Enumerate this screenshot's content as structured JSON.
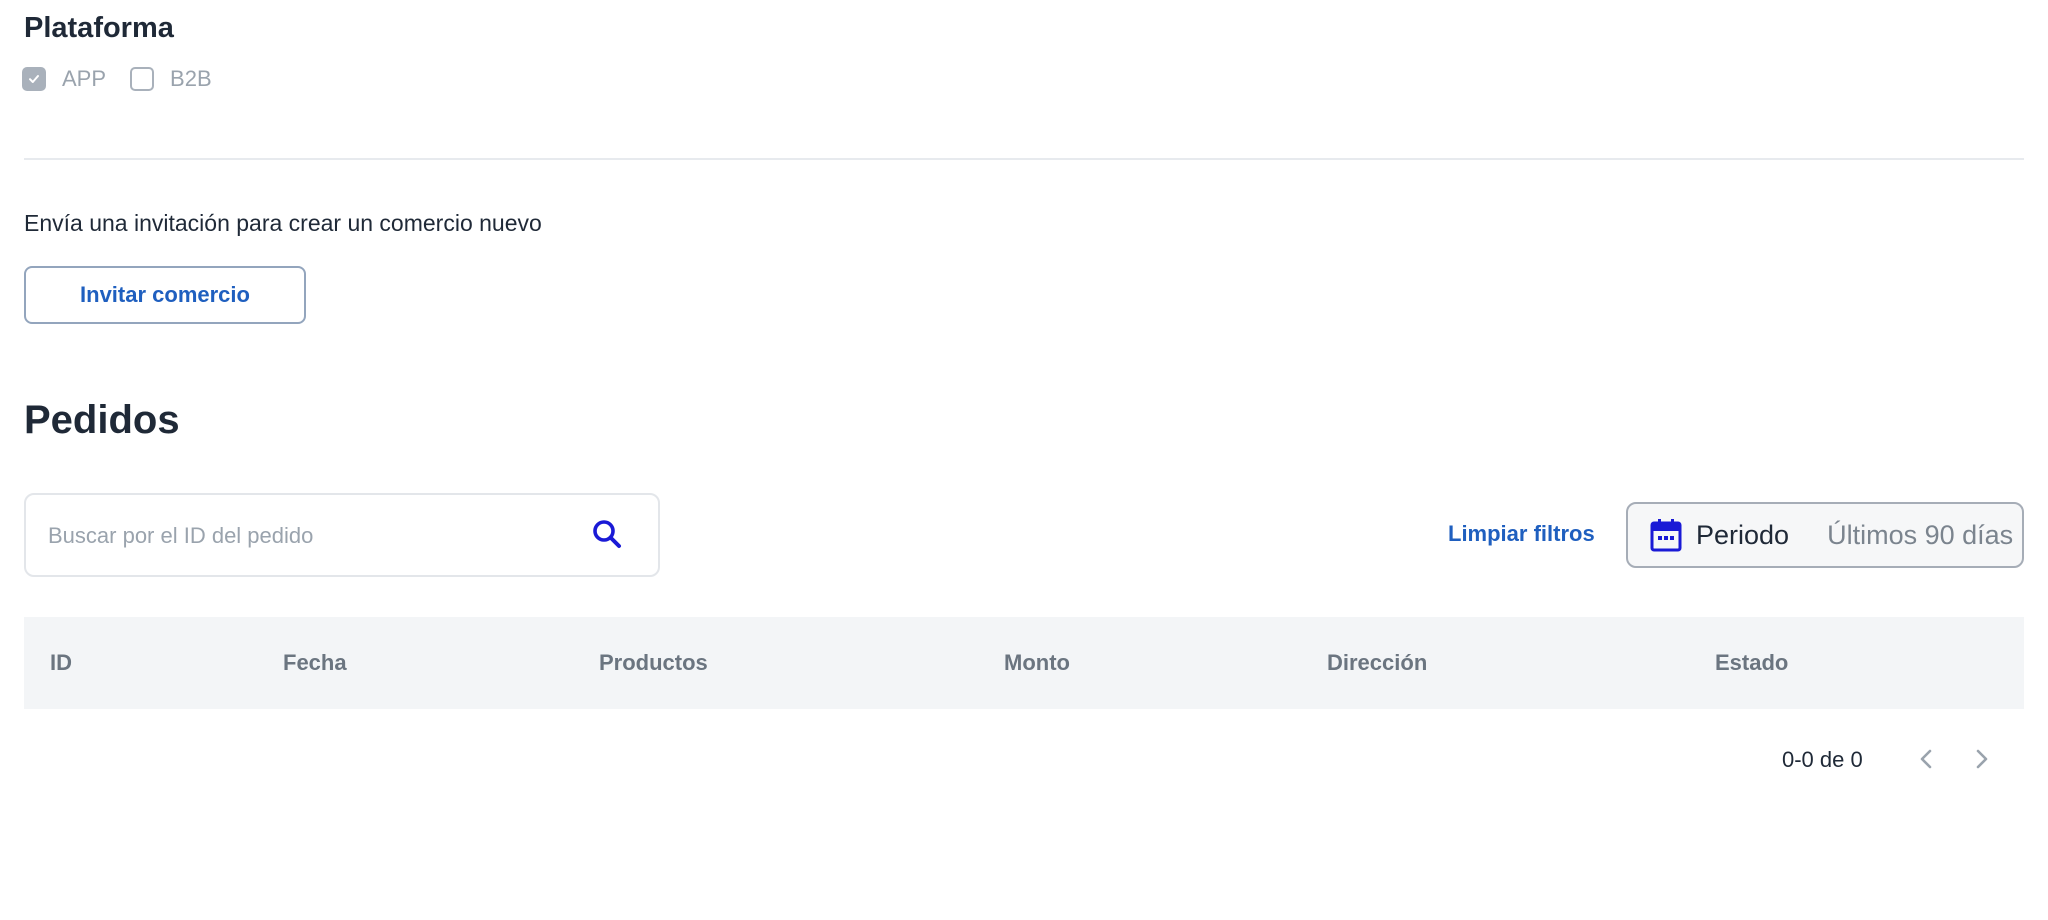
{
  "platform": {
    "title": "Plataforma",
    "options": [
      {
        "label": "APP",
        "checked": true
      },
      {
        "label": "B2B",
        "checked": false
      }
    ]
  },
  "invite": {
    "text": "Envía una invitación para crear un comercio nuevo",
    "button_label": "Invitar comercio"
  },
  "orders": {
    "title": "Pedidos",
    "search": {
      "placeholder": "Buscar por el ID del pedido",
      "value": "",
      "icon": "search-icon"
    },
    "clear_filters_label": "Limpiar filtros",
    "period": {
      "icon": "calendar-icon",
      "label": "Periodo",
      "value": "Últimos 90 días"
    },
    "table": {
      "columns": [
        "ID",
        "Fecha",
        "Productos",
        "Monto",
        "Dirección",
        "Estado"
      ],
      "rows": []
    },
    "pagination": {
      "text": "0-0 de 0",
      "prev_icon": "chevron-left-icon",
      "next_icon": "chevron-right-icon"
    }
  },
  "colors": {
    "accent": "#1f5fbf",
    "icon_blue": "#1a1ad6",
    "text_dark": "#1f2937",
    "muted": "#9aa3ad",
    "header_bg": "#f3f5f7"
  }
}
